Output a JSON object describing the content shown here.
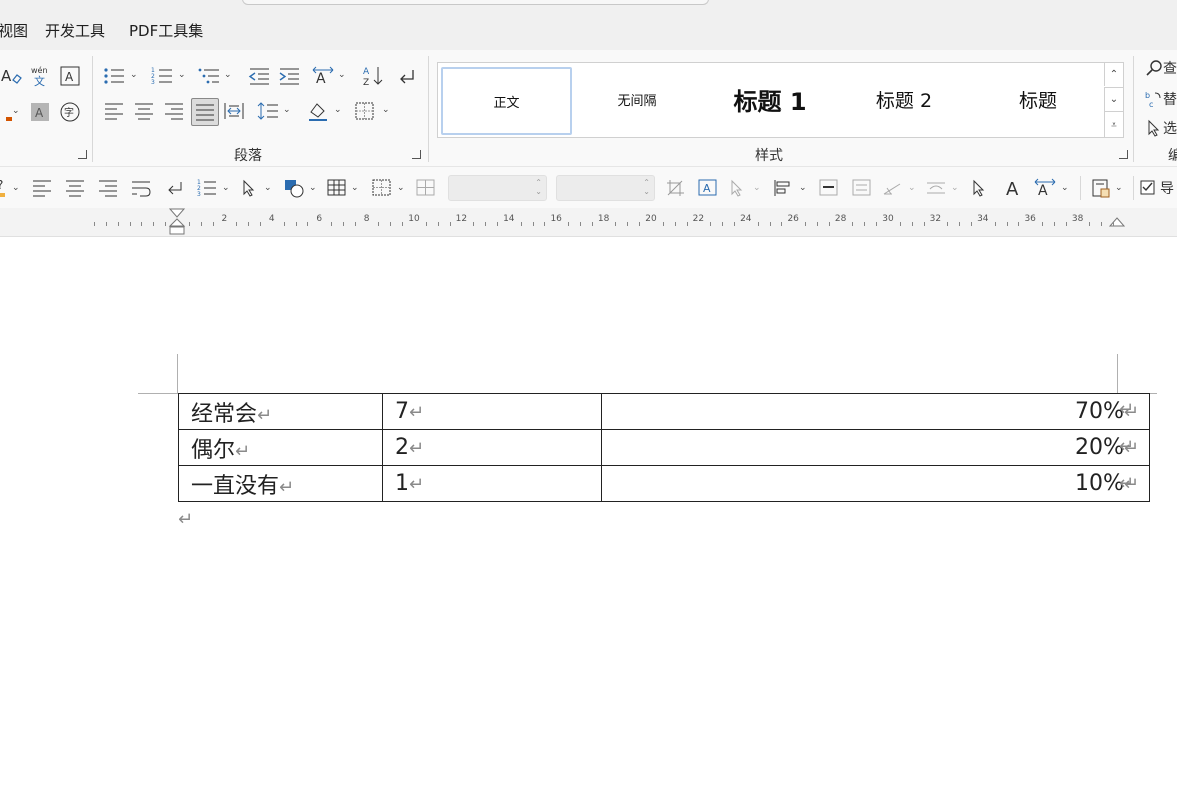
{
  "menu": {
    "tabs": [
      "视图",
      "开发工具",
      "PDF工具集"
    ]
  },
  "ribbon": {
    "paragraph_group_label": "段落",
    "styles_group_label": "样式",
    "styles": [
      {
        "label": "正文",
        "active": true
      },
      {
        "label": "无间隔",
        "active": false
      },
      {
        "label": "标题 1",
        "active": false
      },
      {
        "label": "标题 2",
        "active": false
      },
      {
        "label": "标题",
        "active": false
      }
    ],
    "right_group_partial": [
      "查",
      "替",
      "选"
    ],
    "right_group_label_partial": "编"
  },
  "toolbar2": {
    "width_field_value": "",
    "height_field_value": "",
    "navpane_partial": "导"
  },
  "ruler": {
    "labels": [
      "2",
      "4",
      "6",
      "8",
      "10",
      "12",
      "14",
      "16",
      "18",
      "20",
      "22",
      "24",
      "26",
      "28",
      "30",
      "32",
      "34",
      "36",
      "38"
    ]
  },
  "table": {
    "rows": [
      {
        "label": "经常会",
        "count": "7",
        "percent": "70%"
      },
      {
        "label": "偶尔",
        "count": "2",
        "percent": "20%"
      },
      {
        "label": "一直没有",
        "count": "1",
        "percent": "10%"
      }
    ]
  },
  "marks": {
    "paragraph": "↵"
  },
  "colors": {
    "accent_orange": "#d35400",
    "style_highlight": "#b8d0ee"
  }
}
